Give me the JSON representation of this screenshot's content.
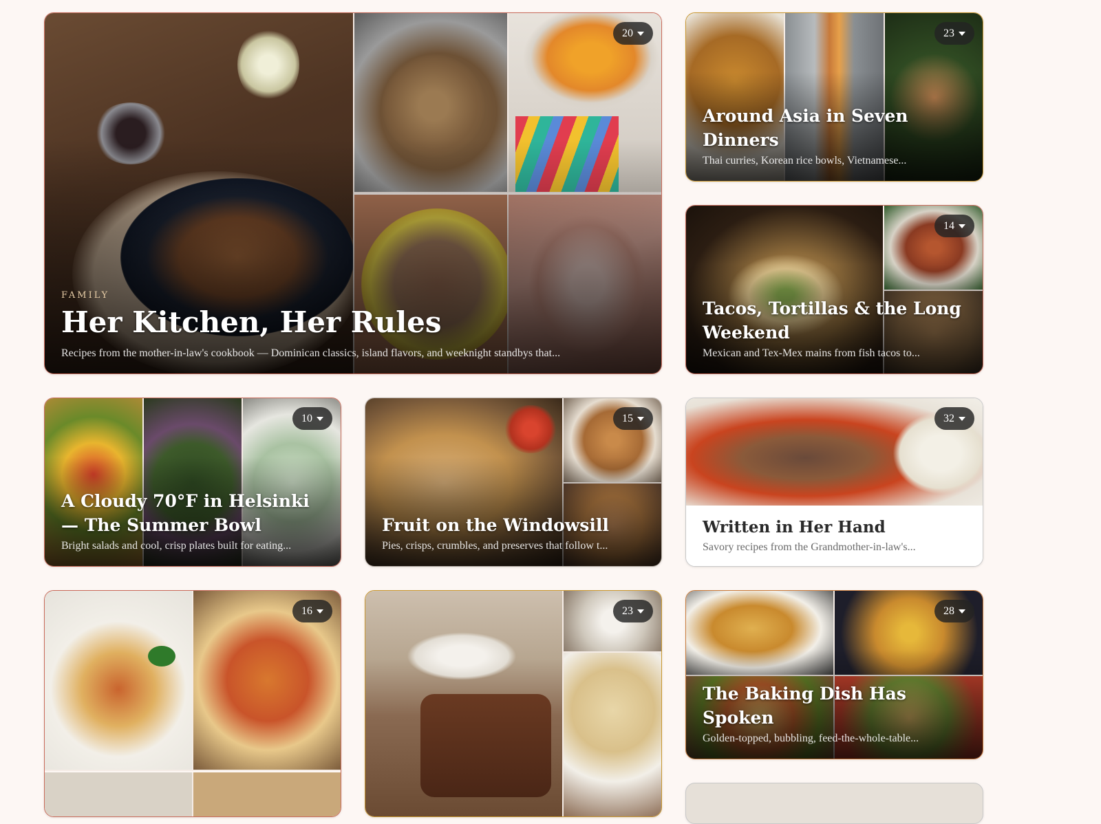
{
  "collections": [
    {
      "eyebrow": "FAMILY",
      "title": "Her Kitchen, Her Rules",
      "description": "Recipes from the mother-in-law's cookbook — Dominican classics, island flavors, and weeknight standbys that...",
      "count": "20"
    },
    {
      "title": "Around Asia in Seven Dinners",
      "description": "Thai curries, Korean rice bowls, Vietnamese...",
      "count": "23"
    },
    {
      "title": "Tacos, Tortillas & the Long Weekend",
      "description": "Mexican and Tex-Mex mains from fish tacos to...",
      "count": "14"
    },
    {
      "title": "A Cloudy 70°F in Helsinki — The Summer Bowl",
      "description": "Bright salads and cool, crisp plates built for eating...",
      "count": "10"
    },
    {
      "title": "Fruit on the Windowsill",
      "description": "Pies, crisps, crumbles, and preserves that follow t...",
      "count": "15"
    },
    {
      "title": "Written in Her Hand",
      "description": "Savory recipes from the Grandmother-in-law's...",
      "count": "32"
    },
    {
      "title": "",
      "description": "",
      "count": "16"
    },
    {
      "title": "",
      "description": "",
      "count": "23"
    },
    {
      "title": "The Baking Dish Has Spoken",
      "description": "Golden-topped, bubbling, feed-the-whole-table...",
      "count": "28"
    }
  ],
  "images": [
    "family-dinner-table-photo",
    "bean-stew-pot-photo",
    "fried-plantains-photo",
    "rice-and-beans-bowl-photo",
    "chicken-casserole-photo",
    "curry-rice-photo",
    "kebab-skewers-photo",
    "chicken-and-greens-photo",
    "tacos-plate-photo",
    "enchiladas-photo",
    "rice-dish-photo",
    "corn-salad-photo",
    "kale-salad-photo",
    "cucumber-salad-photo",
    "apple-pie-photo",
    "crumble-dish-photo",
    "peach-pie-photo",
    "pepper-steak-photo",
    "lasagna-plate-photo",
    "baked-ziti-photo",
    "chocolate-cake-photo",
    "flour-bowl-photo",
    "sugar-cookies-photo",
    "gratin-dish-photo",
    "mac-cheese-photo",
    "veggie-bake-photo"
  ],
  "colors": {
    "page_background": "#fdf7f4",
    "card_border_red": "#c96a5a",
    "card_border_gold": "#c9962e",
    "badge_background": "#232323"
  }
}
